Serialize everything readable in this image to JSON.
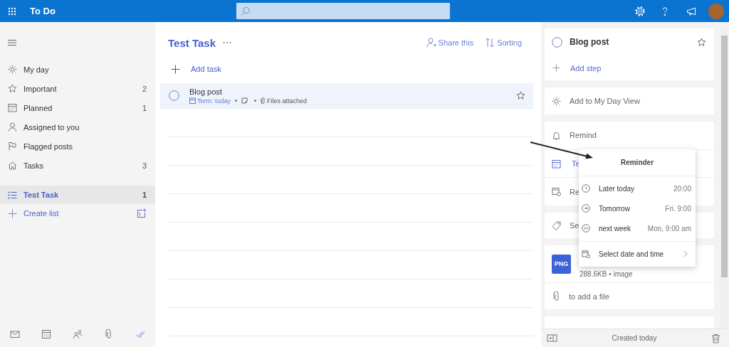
{
  "top_bar": {
    "app_name": "To Do"
  },
  "sidebar": {
    "items": [
      {
        "label": "My day",
        "selected": false
      },
      {
        "label": "Important",
        "count": "2",
        "selected": false
      },
      {
        "label": "Planned",
        "count": "1",
        "selected": false
      },
      {
        "label": "Assigned to you",
        "selected": false
      },
      {
        "label": "Flagged posts",
        "selected": false
      },
      {
        "label": "Tasks",
        "count": "3",
        "selected": false
      }
    ],
    "lists": [
      {
        "label": "Test Task",
        "count": "1",
        "selected": true
      }
    ],
    "create_list": "Create list",
    "apps": [
      {
        "selected": false
      },
      {
        "selected": false
      },
      {
        "selected": false
      },
      {
        "selected": false
      },
      {
        "selected": true
      }
    ]
  },
  "list": {
    "title": "Test Task",
    "actions": [
      "Share this",
      "Sorting"
    ],
    "add_task": "Add task",
    "tasks": [
      {
        "title": "Blog post",
        "completed": false,
        "important": false,
        "selected": true,
        "due": "Term: today",
        "files": "Files attached"
      }
    ]
  },
  "details": {
    "title": "Blog post",
    "completed": false,
    "important": false,
    "add_step": "Add step",
    "my_day": "Add to My Day View",
    "rows": [
      {
        "kind": "remind",
        "label": "Remind",
        "active": false
      },
      {
        "kind": "due",
        "label": "Te",
        "active": true
      },
      {
        "kind": "repeat",
        "label": "Re",
        "active": false
      }
    ],
    "category": "Se",
    "file": {
      "type": "PNG",
      "meta": "288.6KB • image"
    },
    "add_file": "to add a file",
    "created": "Created today"
  },
  "reminder_menu": {
    "title": "Reminder",
    "options": [
      {
        "label": "Later today",
        "time": "20:00"
      },
      {
        "label": "Tomorrow",
        "time": "Fri. 9:00"
      },
      {
        "label": "next week",
        "time": "Mon, 9:00 am"
      }
    ],
    "custom": "Select date and time"
  }
}
